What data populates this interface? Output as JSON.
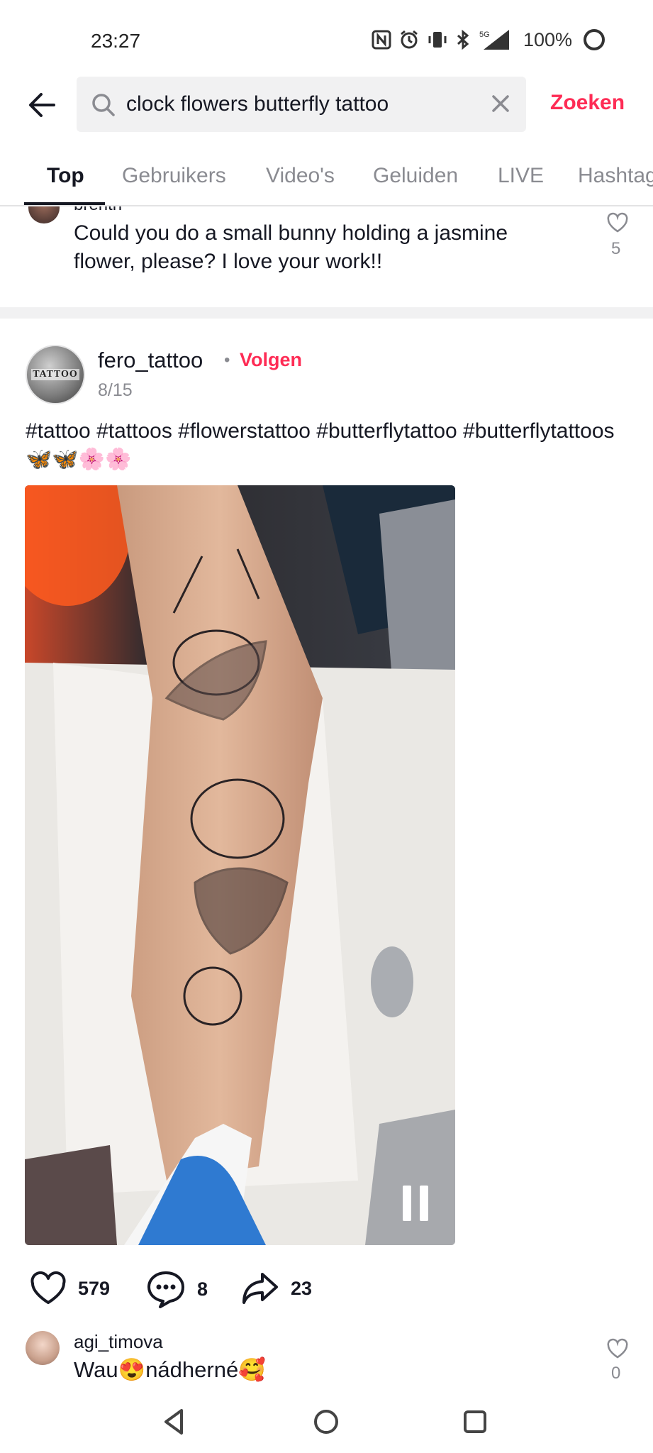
{
  "status_bar": {
    "time": "23:27",
    "icons": [
      "nfc-icon",
      "alarm-icon",
      "vibrate-icon",
      "bluetooth-icon",
      "signal-5g-icon"
    ],
    "network": "5G",
    "battery": "100%"
  },
  "search": {
    "query": "clock flowers butterfly tattoo",
    "submit_label": "Zoeken"
  },
  "tabs": [
    {
      "label": "Top",
      "active": true
    },
    {
      "label": "Gebruikers",
      "active": false
    },
    {
      "label": "Video's",
      "active": false
    },
    {
      "label": "Geluiden",
      "active": false
    },
    {
      "label": "LIVE",
      "active": false
    },
    {
      "label": "Hashtag",
      "active": false
    }
  ],
  "previous_comment": {
    "username": "brenth",
    "text": "Could you do a small bunny holding a jasmine flower, please? I love your work!!",
    "likes": "5"
  },
  "post": {
    "username": "fero_tattoo",
    "avatar_text": "TATTOO",
    "follow_label": "Volgen",
    "counter": "8/15",
    "caption": "#tattoo #tattoos #flowerstattoo #butterflytattoo #butterflytattoos 🦋🦋🌸🌸",
    "likes": "579",
    "comments": "8",
    "shares": "23"
  },
  "bottom_comment": {
    "username": "agi_timova",
    "text": "Wau😍nádherné🥰",
    "likes": "0"
  },
  "colors": {
    "accent": "#fe2c55",
    "text": "#161823",
    "muted": "#8a8b91",
    "search_bg": "#f1f1f2"
  }
}
